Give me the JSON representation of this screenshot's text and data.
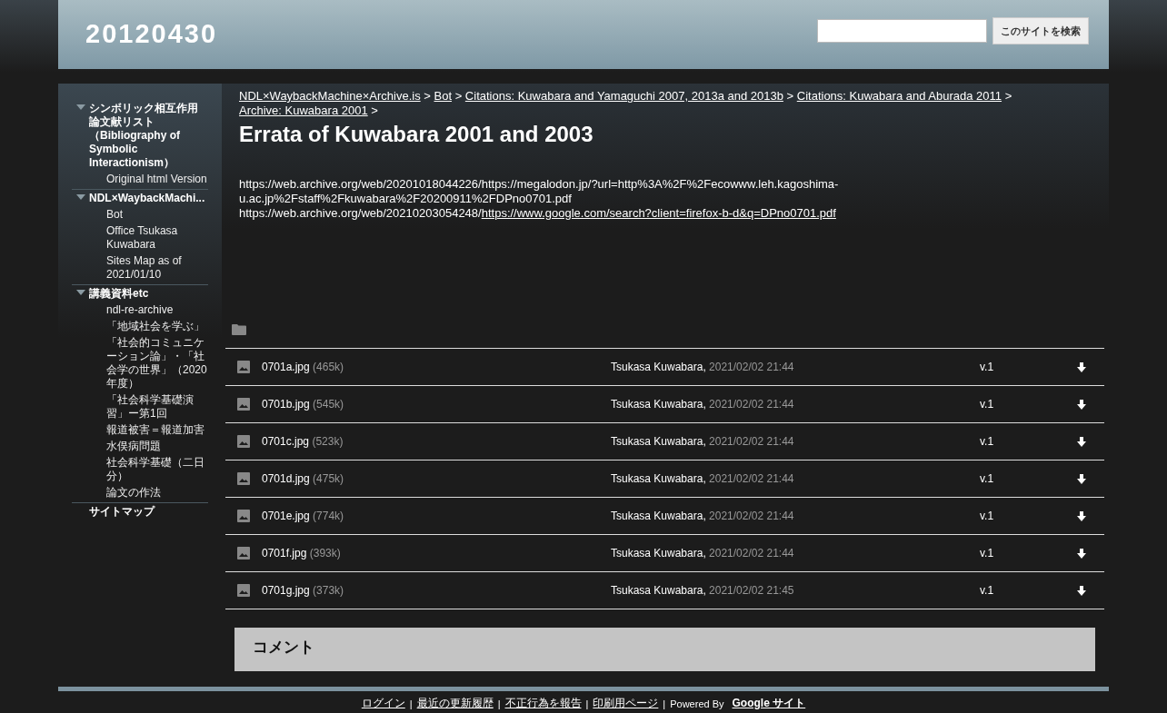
{
  "site_title": "20120430",
  "search": {
    "button": "このサイトを検索"
  },
  "sidebar": {
    "items": [
      {
        "label": "シンボリック相互作用論文献リスト（Bibliography of Symbolic Interactionism）",
        "expanded": true,
        "children": [
          {
            "label": "Original html Version"
          }
        ]
      },
      {
        "label": "NDL×WaybackMachi...",
        "expanded": true,
        "children": [
          {
            "label": "Bot"
          },
          {
            "label": "Office Tsukasa Kuwabara"
          },
          {
            "label": "Sites Map as of 2021/01/10"
          }
        ]
      },
      {
        "label": "講義資料etc",
        "expanded": true,
        "children": [
          {
            "label": "ndl-re-archive"
          },
          {
            "label": "「地域社会を学ぶ」"
          },
          {
            "label": "「社会的コミュニケーション論」・「社会学の世界」（2020年度）"
          },
          {
            "label": "「社会科学基礎演習」ー第1回"
          },
          {
            "label": "報道被害＝報道加害"
          },
          {
            "label": "水俣病問題"
          },
          {
            "label": "社会科学基礎（二日分）"
          },
          {
            "label": "論文の作法"
          }
        ]
      },
      {
        "label": "サイトマップ"
      }
    ]
  },
  "breadcrumb": [
    "NDL×WaybackMachine×Archive.is",
    "Bot",
    "Citations: Kuwabara and Yamaguchi 2007, 2013a and 2013b",
    "Citations: Kuwabara and Aburada 2011",
    "Archive: Kuwabara 2001"
  ],
  "breadcrumb_separator": ">",
  "page_title": "Errata of Kuwabara 2001 and 2003",
  "body": [
    {
      "text": "https://web.archive.org/web/20201018044226/https://megalodon.jp/?url=http%3A%2F%2Fecowww.leh.kagoshima-u.ac.jp%2Fstaff%2Fkuwabara%2F20200911%2FDPno0701.pdf"
    },
    {
      "text": "https://web.archive.org/web/20210203054248/",
      "link": "https://www.google.com/search?client=firefox-b-d&q=DPno0701.pdf"
    }
  ],
  "files": [
    {
      "name": "0701a.jpg",
      "size": "(465k)",
      "author": "Tsukasa Kuwabara,",
      "date": "2021/02/02 21:44",
      "version": "v.1"
    },
    {
      "name": "0701b.jpg",
      "size": "(545k)",
      "author": "Tsukasa Kuwabara,",
      "date": "2021/02/02 21:44",
      "version": "v.1"
    },
    {
      "name": "0701c.jpg",
      "size": "(523k)",
      "author": "Tsukasa Kuwabara,",
      "date": "2021/02/02 21:44",
      "version": "v.1"
    },
    {
      "name": "0701d.jpg",
      "size": "(475k)",
      "author": "Tsukasa Kuwabara,",
      "date": "2021/02/02 21:44",
      "version": "v.1"
    },
    {
      "name": "0701e.jpg",
      "size": "(774k)",
      "author": "Tsukasa Kuwabara,",
      "date": "2021/02/02 21:44",
      "version": "v.1"
    },
    {
      "name": "0701f.jpg",
      "size": "(393k)",
      "author": "Tsukasa Kuwabara,",
      "date": "2021/02/02 21:44",
      "version": "v.1"
    },
    {
      "name": "0701g.jpg",
      "size": "(373k)",
      "author": "Tsukasa Kuwabara,",
      "date": "2021/02/02 21:45",
      "version": "v.1"
    }
  ],
  "comments": {
    "title": "コメント"
  },
  "footer": {
    "links": [
      "ログイン",
      "最近の更新履歴",
      "不正行為を報告",
      "印刷用ページ"
    ],
    "separator": "|",
    "powered_by": "Powered By",
    "brand": "Google サイト"
  }
}
